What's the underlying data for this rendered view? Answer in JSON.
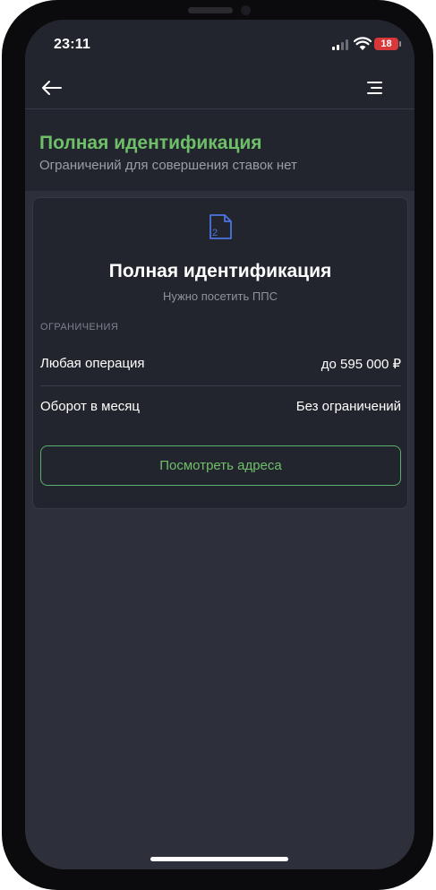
{
  "status_bar": {
    "time": "23:11",
    "battery_level": "18",
    "signal_bars": 2,
    "battery_color": "#d9383a"
  },
  "nav": {
    "back_icon": "arrow-left-icon",
    "menu_icon": "hamburger-menu-icon"
  },
  "header": {
    "title": "Полная идентификация",
    "subtitle": "Ограничений для совершения ставок нет"
  },
  "card": {
    "icon": "document-2-icon",
    "icon_digit": "2",
    "title": "Полная идентификация",
    "subtitle": "Нужно посетить ППС",
    "section_label": "ОГРАНИЧЕНИЯ",
    "rows": [
      {
        "label": "Любая операция",
        "value": "до 595 000 ₽"
      },
      {
        "label": "Оборот в месяц",
        "value": "Без ограничений"
      }
    ],
    "button_label": "Посмотреть адреса"
  },
  "colors": {
    "accent_green": "#6fbf69",
    "icon_blue": "#4b74e0",
    "background": "#2d303a",
    "surface": "#22252e"
  }
}
